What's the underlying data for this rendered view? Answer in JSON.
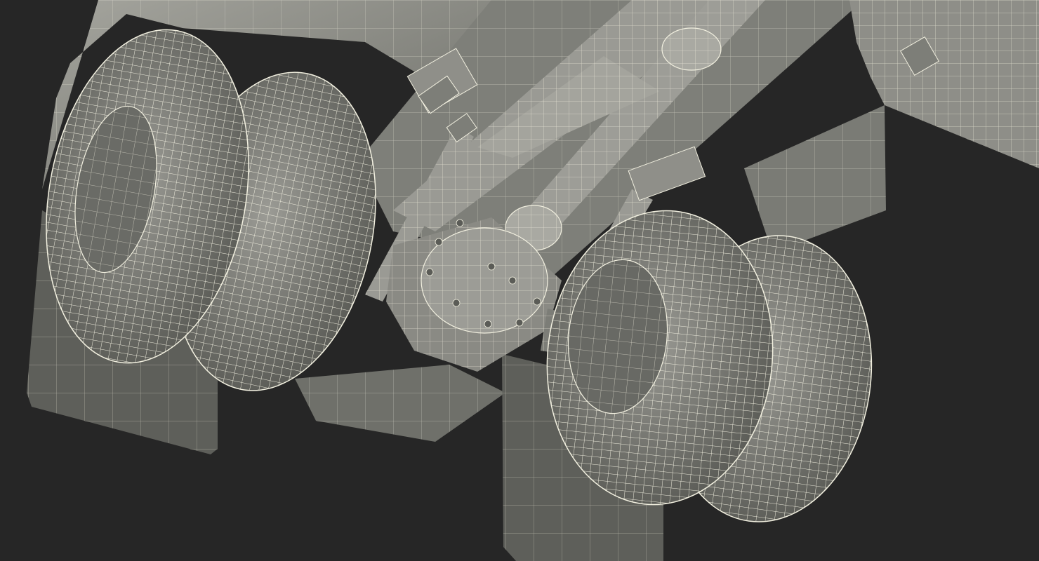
{
  "scene": {
    "subject": "wireframe-truck-undercarriage",
    "background_color": "#262626",
    "surface_color": "#8c8c86",
    "surface_dark": "#5f605b",
    "surface_light": "#b3b3ac",
    "wire_color": "#f2f0e0",
    "shadow_color": "#1c1c1c"
  }
}
